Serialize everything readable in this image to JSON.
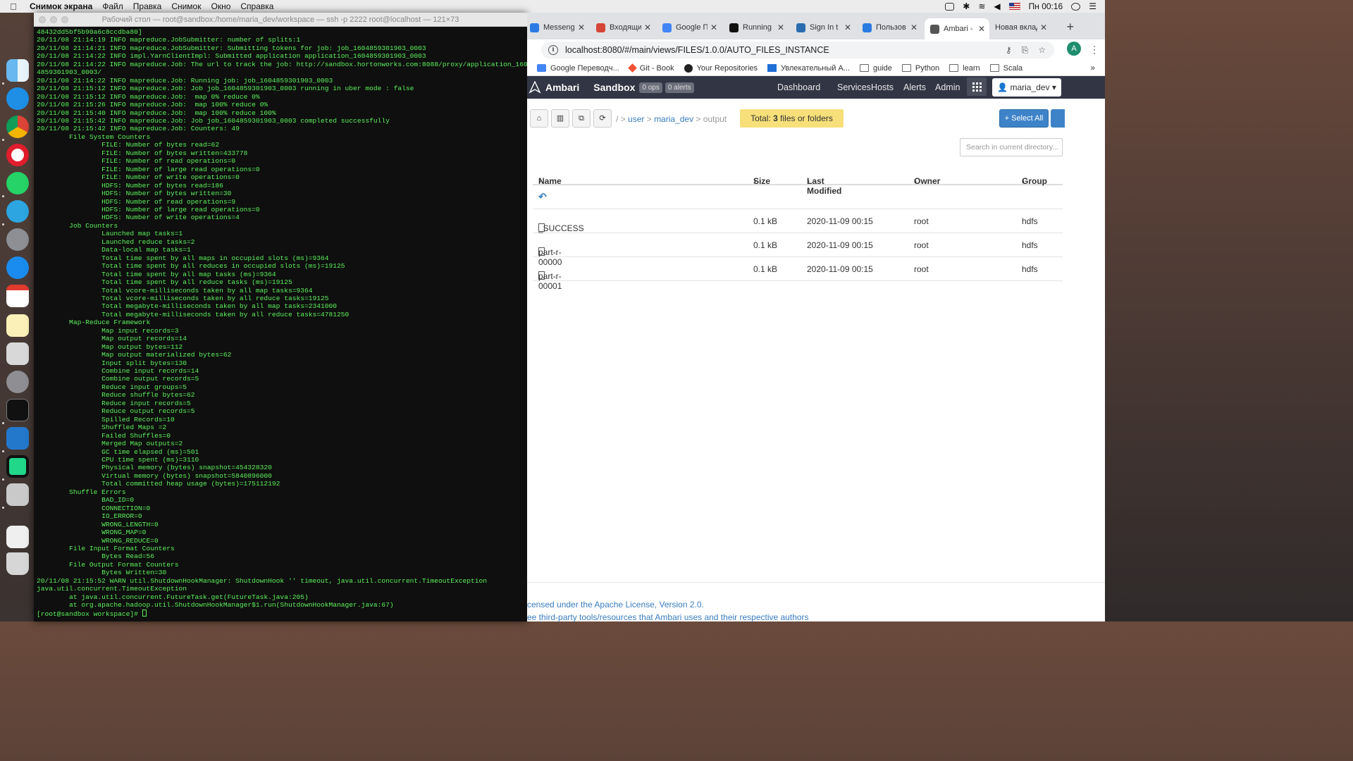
{
  "menubar": {
    "apple_icon": "apple-icon",
    "app_name": "Снимок экрана",
    "items": [
      "Файл",
      "Правка",
      "Снимок",
      "Окно",
      "Справка"
    ],
    "clock": "Пн 00:16"
  },
  "terminal": {
    "title": "Рабочий стол — root@sandbox:/home/maria_dev/workspace — ssh -p 2222 root@localhost — 121×73",
    "lines": [
      "48432dd5bf5b90a6c8ccdba80]",
      "20/11/08 21:14:19 INFO mapreduce.JobSubmitter: number of splits:1",
      "20/11/08 21:14:21 INFO mapreduce.JobSubmitter: Submitting tokens for job: job_1604859301903_0003",
      "20/11/08 21:14:22 INFO impl.YarnClientImpl: Submitted application application_1604859301903_0003",
      "20/11/08 21:14:22 INFO mapreduce.Job: The url to track the job: http://sandbox.hortonworks.com:8088/proxy/application_160",
      "4859301903_0003/",
      "20/11/08 21:14:22 INFO mapreduce.Job: Running job: job_1604859301903_0003",
      "20/11/08 21:15:12 INFO mapreduce.Job: Job job_1604859301903_0003 running in uber mode : false",
      "20/11/08 21:15:12 INFO mapreduce.Job:  map 0% reduce 0%",
      "20/11/08 21:15:26 INFO mapreduce.Job:  map 100% reduce 0%",
      "20/11/08 21:15:40 INFO mapreduce.Job:  map 100% reduce 100%",
      "20/11/08 21:15:42 INFO mapreduce.Job: Job job_1604859301903_0003 completed successfully",
      "20/11/08 21:15:42 INFO mapreduce.Job: Counters: 49",
      "        File System Counters",
      "                FILE: Number of bytes read=62",
      "                FILE: Number of bytes written=433778",
      "                FILE: Number of read operations=0",
      "                FILE: Number of large read operations=0",
      "                FILE: Number of write operations=0",
      "                HDFS: Number of bytes read=186",
      "                HDFS: Number of bytes written=30",
      "                HDFS: Number of read operations=9",
      "                HDFS: Number of large read operations=0",
      "                HDFS: Number of write operations=4",
      "        Job Counters",
      "                Launched map tasks=1",
      "                Launched reduce tasks=2",
      "                Data-local map tasks=1",
      "                Total time spent by all maps in occupied slots (ms)=9364",
      "                Total time spent by all reduces in occupied slots (ms)=19125",
      "                Total time spent by all map tasks (ms)=9364",
      "                Total time spent by all reduce tasks (ms)=19125",
      "                Total vcore-milliseconds taken by all map tasks=9364",
      "                Total vcore-milliseconds taken by all reduce tasks=19125",
      "                Total megabyte-milliseconds taken by all map tasks=2341000",
      "                Total megabyte-milliseconds taken by all reduce tasks=4781250",
      "        Map-Reduce Framework",
      "                Map input records=3",
      "                Map output records=14",
      "                Map output bytes=112",
      "                Map output materialized bytes=62",
      "                Input split bytes=130",
      "                Combine input records=14",
      "                Combine output records=5",
      "                Reduce input groups=5",
      "                Reduce shuffle bytes=62",
      "                Reduce input records=5",
      "                Reduce output records=5",
      "                Spilled Records=10",
      "                Shuffled Maps =2",
      "                Failed Shuffles=0",
      "                Merged Map outputs=2",
      "                GC time elapsed (ms)=501",
      "                CPU time spent (ms)=3110",
      "                Physical memory (bytes) snapshot=454328320",
      "                Virtual memory (bytes) snapshot=5840896000",
      "                Total committed heap usage (bytes)=175112192",
      "        Shuffle Errors",
      "                BAD_ID=0",
      "                CONNECTION=0",
      "                IO_ERROR=0",
      "                WRONG_LENGTH=0",
      "                WRONG_MAP=0",
      "                WRONG_REDUCE=0",
      "        File Input Format Counters",
      "                Bytes Read=56",
      "        File Output Format Counters",
      "                Bytes Written=30",
      "20/11/08 21:15:52 WARN util.ShutdownHookManager: ShutdownHook '' timeout, java.util.concurrent.TimeoutException",
      "java.util.concurrent.TimeoutException",
      "        at java.util.concurrent.FutureTask.get(FutureTask.java:205)",
      "        at org.apache.hadoop.util.ShutdownHookManager$1.run(ShutdownHookManager.java:67)"
    ],
    "prompt": "[root@sandbox workspace]# "
  },
  "browser": {
    "tabs": [
      {
        "label": "Messeng",
        "color": "#2c7be5"
      },
      {
        "label": "Входящи",
        "color": "#d44638"
      },
      {
        "label": "Google П",
        "color": "#4285f4"
      },
      {
        "label": "Running",
        "color": "#111111"
      },
      {
        "label": "Sign In t",
        "color": "#2b6cb0"
      },
      {
        "label": "Пользов",
        "color": "#2a7be0"
      },
      {
        "label": "Ambari -",
        "color": "#555555"
      },
      {
        "label": "Новая вклад",
        "color": "#dddddd"
      }
    ],
    "url": "localhost:8080/#/main/views/FILES/1.0.0/AUTO_FILES_INSTANCE",
    "avatar_letter": "A",
    "bookmarks": [
      "Google Переводч...",
      "Git - Book",
      "Your Repositories",
      "Увлекательный А...",
      "guide",
      "Python",
      "learn",
      "Scala"
    ],
    "bookmarks_more": "»"
  },
  "ambari": {
    "brand": "Ambari",
    "cluster": "Sandbox",
    "ops_badge": "0 ops",
    "alerts_badge": "0 alerts",
    "nav": [
      "Dashboard",
      "Services",
      "Hosts",
      "Alerts",
      "Admin"
    ],
    "user": "maria_dev ▾",
    "breadcrumb": {
      "root": "/",
      "parts": [
        "user",
        "maria_dev",
        "output"
      ]
    },
    "total": {
      "prefix": "Total: ",
      "count": "3",
      "suffix": " files or folders"
    },
    "select_all": "+ Select All",
    "search_placeholder": "Search in current directory...",
    "columns": [
      "Name",
      "Size",
      "Last Modified",
      "Owner",
      "Group"
    ],
    "files": [
      {
        "name": "_SUCCESS",
        "size": "0.1 kB",
        "modified": "2020-11-09 00:15",
        "owner": "root",
        "group": "hdfs"
      },
      {
        "name": "part-r-00000",
        "size": "0.1 kB",
        "modified": "2020-11-09 00:15",
        "owner": "root",
        "group": "hdfs"
      },
      {
        "name": "part-r-00001",
        "size": "0.1 kB",
        "modified": "2020-11-09 00:15",
        "owner": "root",
        "group": "hdfs"
      }
    ],
    "footer": [
      "censed under the Apache License, Version 2.0.",
      "ee third-party tools/resources that Ambari uses and their respective authors"
    ]
  },
  "colors": {
    "terminal_text": "#5ef05e",
    "ambari_nav": "#323544",
    "link": "#3a7dc0",
    "total_badge": "#f7e07a"
  }
}
